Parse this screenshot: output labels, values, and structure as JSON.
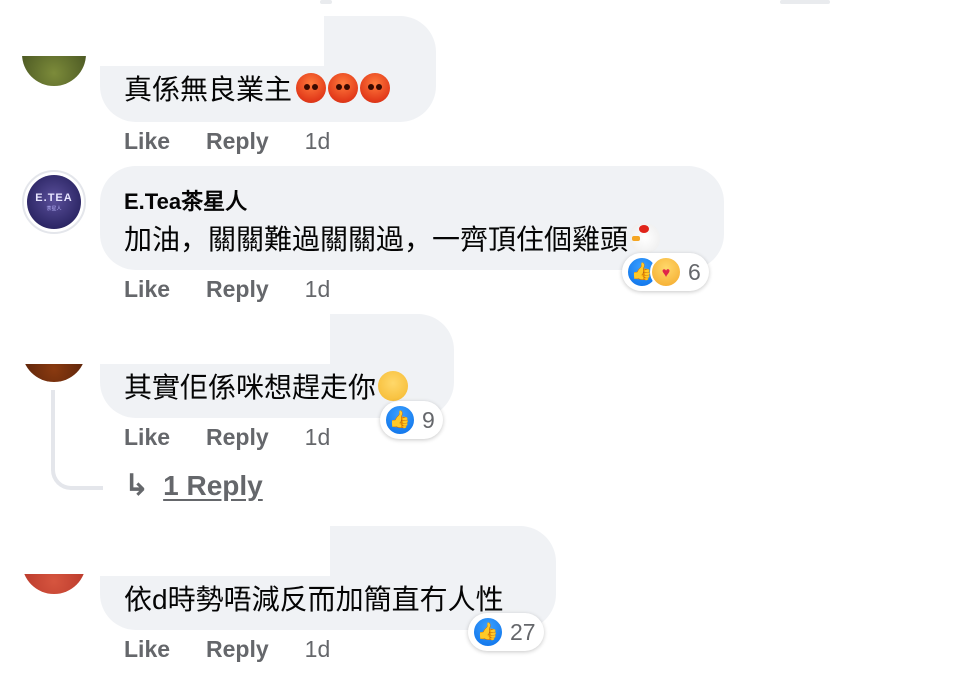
{
  "actions": {
    "like": "Like",
    "reply": "Reply"
  },
  "comments": [
    {
      "author": "",
      "text": "真係無良業主",
      "emojis": [
        "angry-face-icon",
        "angry-face-icon",
        "angry-face-icon"
      ],
      "time": "1d"
    },
    {
      "author": "E.Tea茶星人",
      "avatar_text": "E.TEA",
      "avatar_sub": "茶星人",
      "text": "加油，關關難過關關過，一齊頂住個雞頭",
      "emojis": [
        "chicken-icon"
      ],
      "time": "1d",
      "reactions": {
        "icons": [
          "like-icon",
          "care-icon"
        ],
        "count": "6"
      }
    },
    {
      "author": "",
      "text": "其實佢係咪想趕走你",
      "emojis": [
        "relieved-face-icon"
      ],
      "time": "1d",
      "reactions": {
        "icons": [
          "like-icon"
        ],
        "count": "9"
      },
      "replies_link": "1 Reply"
    },
    {
      "author": "",
      "text": "依d時勢唔減反而加簡直冇人性",
      "time": "1d",
      "reactions": {
        "icons": [
          "like-icon"
        ],
        "count": "27"
      }
    }
  ],
  "colors": {
    "bubble": "#f0f2f5",
    "muted_text": "#65676b",
    "like_blue": "#0a6fe8"
  }
}
